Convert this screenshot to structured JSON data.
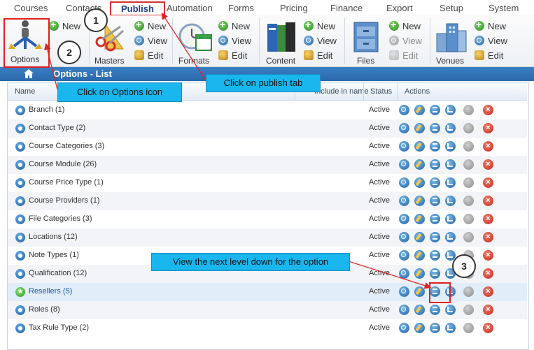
{
  "tabs": [
    {
      "label": "Courses",
      "active": false
    },
    {
      "label": "Contacts",
      "active": false
    },
    {
      "label": "Publish",
      "active": true
    },
    {
      "label": "Automation",
      "active": false
    },
    {
      "label": "Forms",
      "active": false
    },
    {
      "label": "Pricing",
      "active": false
    },
    {
      "label": "Finance",
      "active": false
    },
    {
      "label": "Export",
      "active": false
    },
    {
      "label": "Setup",
      "active": false
    },
    {
      "label": "System",
      "active": false
    }
  ],
  "ribbon": {
    "options_label": "Options",
    "masters_label": "Masters",
    "formats_label": "Formats",
    "content_label": "Content",
    "files_label": "Files",
    "venues_label": "Venues",
    "new_label": "New",
    "view_label": "View",
    "edit_label": "Edit"
  },
  "page_title": "Options - List",
  "grid": {
    "columns": {
      "name": "Name",
      "include": "Include in name",
      "status": "Status",
      "actions": "Actions"
    },
    "rows": [
      {
        "name": "Branch (1)",
        "status": "Active",
        "selected": false
      },
      {
        "name": "Contact Type (2)",
        "status": "Active",
        "selected": false
      },
      {
        "name": "Course Categories (3)",
        "status": "Active",
        "selected": false
      },
      {
        "name": "Course Module (26)",
        "status": "Active",
        "selected": false
      },
      {
        "name": "Course Price Type (1)",
        "status": "Active",
        "selected": false
      },
      {
        "name": "Course Providers (1)",
        "status": "Active",
        "selected": false
      },
      {
        "name": "File Categories (3)",
        "status": "Active",
        "selected": false
      },
      {
        "name": "Locations (12)",
        "status": "Active",
        "selected": false
      },
      {
        "name": "Note Types (1)",
        "status": "Active",
        "selected": false
      },
      {
        "name": "Qualification (12)",
        "status": "Active",
        "selected": false
      },
      {
        "name": "Resellers (5)",
        "status": "Active",
        "selected": true
      },
      {
        "name": "Roles (8)",
        "status": "Active",
        "selected": false
      },
      {
        "name": "Tax Rule Type (2)",
        "status": "Active",
        "selected": false
      }
    ]
  },
  "callouts": {
    "step1_text": "Click on publish tab",
    "step2_text": "Click on Options icon",
    "step3_text": "View the next level down for the option",
    "step1_num": "1",
    "step2_num": "2",
    "step3_num": "3"
  },
  "colors": {
    "accent": "#2a68aa",
    "callout": "#1ab6ee",
    "highlight": "#e02020"
  }
}
